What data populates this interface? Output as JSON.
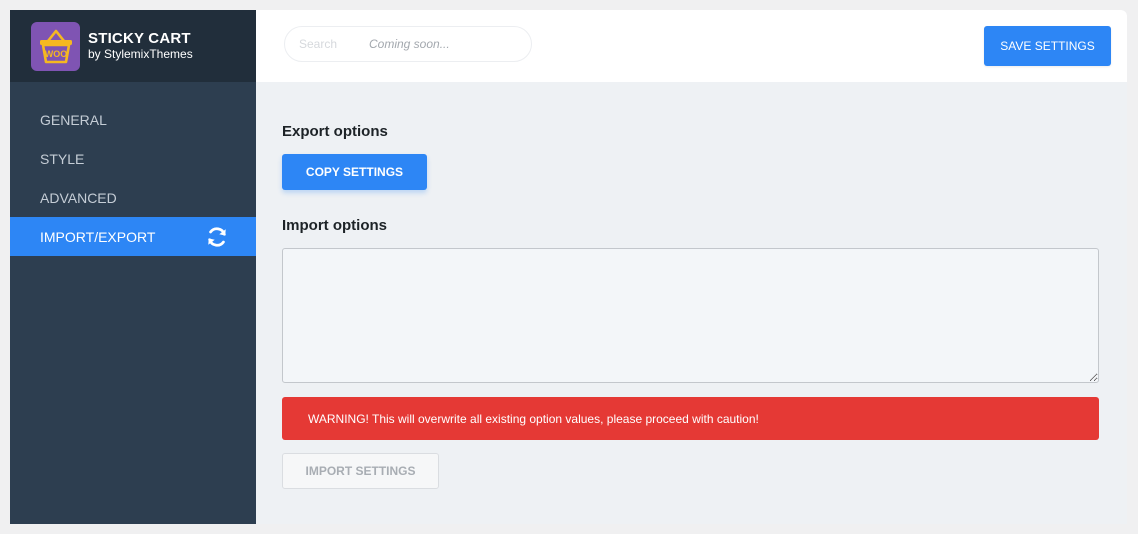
{
  "brand": {
    "title": "STICKY CART",
    "subtitle": "by StylemixThemes",
    "logo_text": "WOO",
    "logo_color": "#7f54b3"
  },
  "sidebar": {
    "items": [
      {
        "label": "GENERAL",
        "active": false
      },
      {
        "label": "STYLE",
        "active": false
      },
      {
        "label": "ADVANCED",
        "active": false
      },
      {
        "label": "IMPORT/EXPORT",
        "active": true,
        "icon": "refresh-icon"
      }
    ]
  },
  "header": {
    "search_placeholder": "Search",
    "search_note": "Coming soon...",
    "save_label": "SAVE SETTINGS"
  },
  "main": {
    "export_title": "Export options",
    "copy_label": "COPY SETTINGS",
    "import_title": "Import options",
    "import_value": "",
    "warning": "WARNING! This will overwrite all existing option values, please proceed with caution!",
    "import_label": "IMPORT SETTINGS"
  },
  "colors": {
    "accent": "#2d86f5",
    "sidebar_bg": "#2d3e50",
    "brand_bg": "#212e3b",
    "warning_bg": "#e53935"
  }
}
